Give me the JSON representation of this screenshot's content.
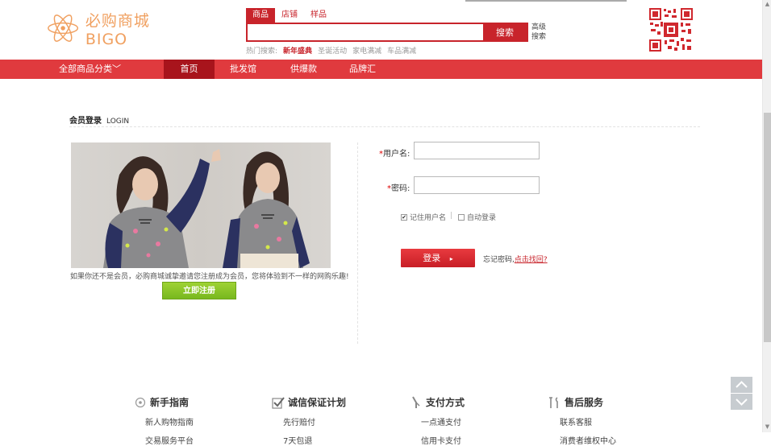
{
  "header": {
    "logo_text": "必购商城 BIGO",
    "search_tabs": [
      "商品",
      "店铺",
      "样品"
    ],
    "search_value": "",
    "search_button": "搜索",
    "advanced_search": "高级搜索",
    "hot_label": "热门搜索:",
    "hot_keywords": [
      "新年盛典",
      "圣诞活动",
      "家电满减",
      "车品满减"
    ]
  },
  "nav": {
    "all_categories": "全部商品分类",
    "items": [
      "首页",
      "批发馆",
      "供爆款",
      "品牌汇"
    ],
    "active_index": 0
  },
  "login": {
    "title": "会员登录",
    "title_en": "LOGIN",
    "register_note": "如果你还不是会员，必购商城诚挚邀请您注册成为会员，您将体验到不一样的网购乐趣!",
    "register_button": "立即注册",
    "username_label": "用户名:",
    "password_label": "密码:",
    "required_mark": "*",
    "username_value": "",
    "password_value": "",
    "remember_label": "记住用户名",
    "remember_checked": true,
    "separator": "|",
    "auto_login_label": "自动登录",
    "auto_login_checked": false,
    "login_button": "登录",
    "forgot_text": "忘记密码,",
    "forgot_link": "点击找回?"
  },
  "footer": {
    "columns": [
      {
        "title": "新手指南",
        "icon": "compass-icon",
        "links": [
          "新人购物指南",
          "交易服务平台"
        ]
      },
      {
        "title": "诚信保证计划",
        "icon": "check-shield-icon",
        "links": [
          "先行赔付",
          "7天包退"
        ]
      },
      {
        "title": "支付方式",
        "icon": "payment-icon",
        "links": [
          "一点通支付",
          "信用卡支付"
        ]
      },
      {
        "title": "售后服务",
        "icon": "tools-icon",
        "links": [
          "联系客服",
          "消费者维权中心"
        ]
      }
    ]
  },
  "colors": {
    "brand_red": "#e03a3e",
    "dark_red": "#a8141c",
    "logo_orange": "#f0a060",
    "register_green": "#8cc62a"
  }
}
